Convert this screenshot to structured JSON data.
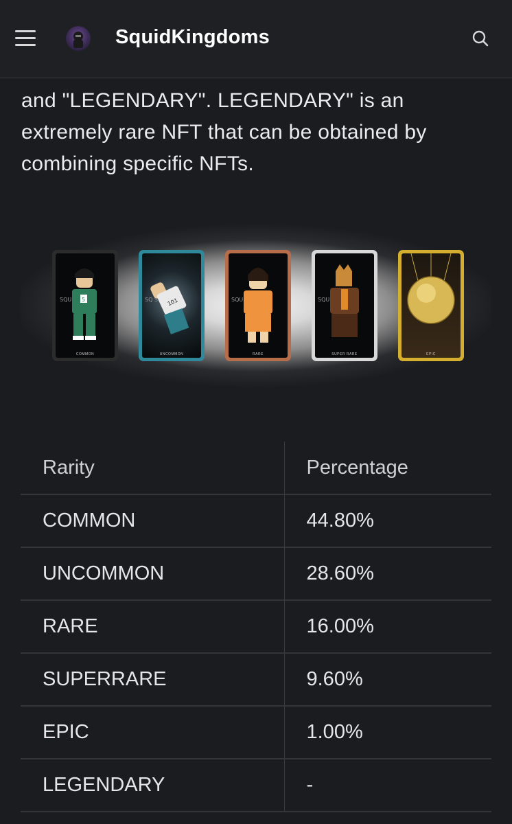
{
  "header": {
    "brand": "SquidKingdoms"
  },
  "intro": {
    "lines": [
      "and \"LEGENDARY\". LEGENDARY\" is an",
      "extremely rare NFT that can be obtained by",
      "combining specific NFTs."
    ]
  },
  "cards": [
    {
      "caption": "COMMON",
      "frame_color": "#2c2c2c",
      "watermark": "SQUID   OM.S"
    },
    {
      "caption": "UNCOMMON",
      "frame_color": "#2e8a9a",
      "watermark": "SQ          S"
    },
    {
      "caption": "RARE",
      "frame_color": "#b86d4a",
      "watermark": "SQU       OM.S"
    },
    {
      "caption": "SUPER RARE",
      "frame_color": "#d8d8d8",
      "watermark": "SQUI      OM.S"
    },
    {
      "caption": "EPIC",
      "frame_color": "#d4af2f",
      "watermark": ""
    }
  ],
  "table": {
    "headers": [
      "Rarity",
      "Percentage"
    ],
    "rows": [
      [
        "COMMON",
        "44.80%"
      ],
      [
        "UNCOMMON",
        "28.60%"
      ],
      [
        "RARE",
        "16.00%"
      ],
      [
        "SUPERRARE",
        "9.60%"
      ],
      [
        "EPIC",
        "1.00%"
      ],
      [
        "LEGENDARY",
        "-"
      ]
    ]
  },
  "icons": {
    "menu": "hamburger-menu-icon",
    "search": "search-icon",
    "logo": "squidkingdoms-logo"
  }
}
